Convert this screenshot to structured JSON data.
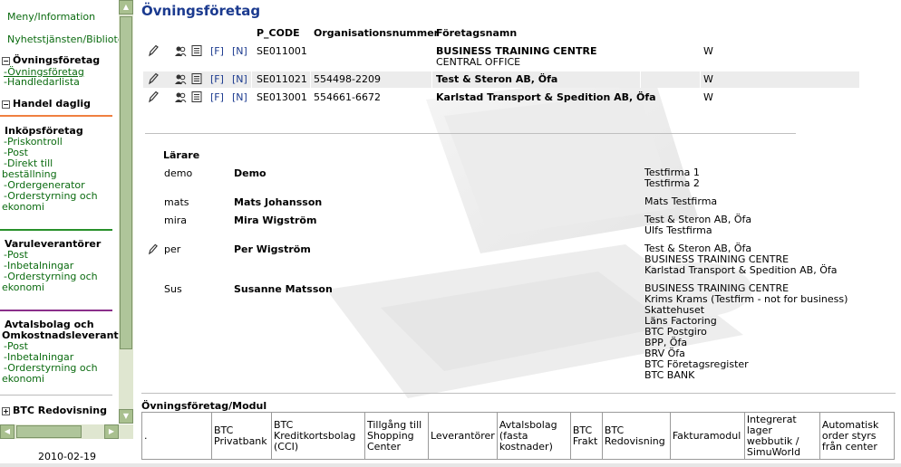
{
  "sidebar": {
    "top_links": [
      "Meny/Information",
      "Nyhetstjänsten/Bibliotek"
    ],
    "sections": {
      "ovningsforetag": {
        "title": "Övningsföretag",
        "toggle": "−",
        "links": [
          "-Övningsföretag",
          "-Handledarlista"
        ]
      },
      "handel": {
        "title": "Handel daglig",
        "toggle": "−"
      },
      "inkop": {
        "title": "Inköpsföretag",
        "links": [
          "-Priskontroll",
          "-Post",
          "-Direkt till",
          "beställning",
          "-Ordergenerator",
          "-Orderstyrning och",
          "ekonomi"
        ]
      },
      "varu": {
        "title": "Varuleverantörer",
        "links": [
          "-Post",
          "-Inbetalningar",
          "-Orderstyrning och",
          "ekonomi"
        ]
      },
      "avtal": {
        "title_lines": [
          "Avtalsbolag och",
          "Omkostnadsleverantö"
        ],
        "links": [
          "-Post",
          "-Inbetalningar",
          "-Orderstyrning och",
          "ekonomi"
        ]
      },
      "btc": {
        "title": "BTC Redovisning",
        "toggle": "+"
      }
    },
    "date": "2010-02-19",
    "scroll_up": "▲",
    "scroll_down": "▼",
    "scroll_left": "◀",
    "scroll_right": "▶"
  },
  "main": {
    "title": "Övningsföretag",
    "columns": {
      "pcode": "P_CODE",
      "orgnr": "Organisationsnummer",
      "name": "Företagsnamn"
    },
    "tag_f": "[F]",
    "tag_n": "[N]",
    "companies": [
      {
        "pcode": "SE011001",
        "orgnr": "",
        "name": "BUSINESS TRAINING CENTRE",
        "name2": "CENTRAL OFFICE",
        "flag": "W"
      },
      {
        "pcode": "SE011021",
        "orgnr": "554498-2209",
        "name": "Test & Steron AB, Öfa",
        "name2": "",
        "flag": "W"
      },
      {
        "pcode": "SE013001",
        "orgnr": "554661-6672",
        "name": "Karlstad Transport & Spedition AB, Öfa",
        "name2": "",
        "flag": "W"
      }
    ],
    "teachers_label": "Lärare",
    "teachers": [
      {
        "user": "demo",
        "name": "Demo",
        "firms": [
          "Testfirma 1",
          "Testfirma 2"
        ]
      },
      {
        "user": "mats",
        "name": "Mats Johansson",
        "firms": [
          "Mats Testfirma"
        ]
      },
      {
        "user": "mira",
        "name": "Mira Wigström",
        "firms": [
          "Test & Steron AB, Öfa",
          "Ulfs Testfirma"
        ]
      },
      {
        "user": "per",
        "name": "Per Wigström",
        "firms": [
          "Test & Steron AB, Öfa",
          "BUSINESS TRAINING CENTRE",
          "Karlstad Transport & Spedition AB, Öfa"
        ]
      },
      {
        "user": "Sus",
        "name": "Susanne Matsson",
        "firms": [
          "BUSINESS TRAINING CENTRE",
          "Krims Krams (Testfirm - not for business)",
          "Skattehuset",
          "Läns Factoring",
          "BTC Postgiro",
          "BPP, Öfa",
          "BRV Öfa",
          "BTC Företagsregister",
          "BTC BANK"
        ]
      }
    ],
    "module_title": "Övningsföretag/Modul",
    "module_columns": [
      ".",
      "BTC Privatbank",
      "BTC Kreditkortsbolag (CCI)",
      "Tillgång till Shopping Center",
      "Leverantörer",
      "Avtalsbolag (fasta kostnader)",
      "BTC Frakt",
      "BTC Redovisning",
      "Fakturamodul",
      "Integrerat lager webbutik / SimuWorld",
      "Automatisk order styrs från center"
    ]
  },
  "colors": {
    "title": "#1b3a8f",
    "link": "#0b6b10",
    "scroll": "#afc59a"
  }
}
